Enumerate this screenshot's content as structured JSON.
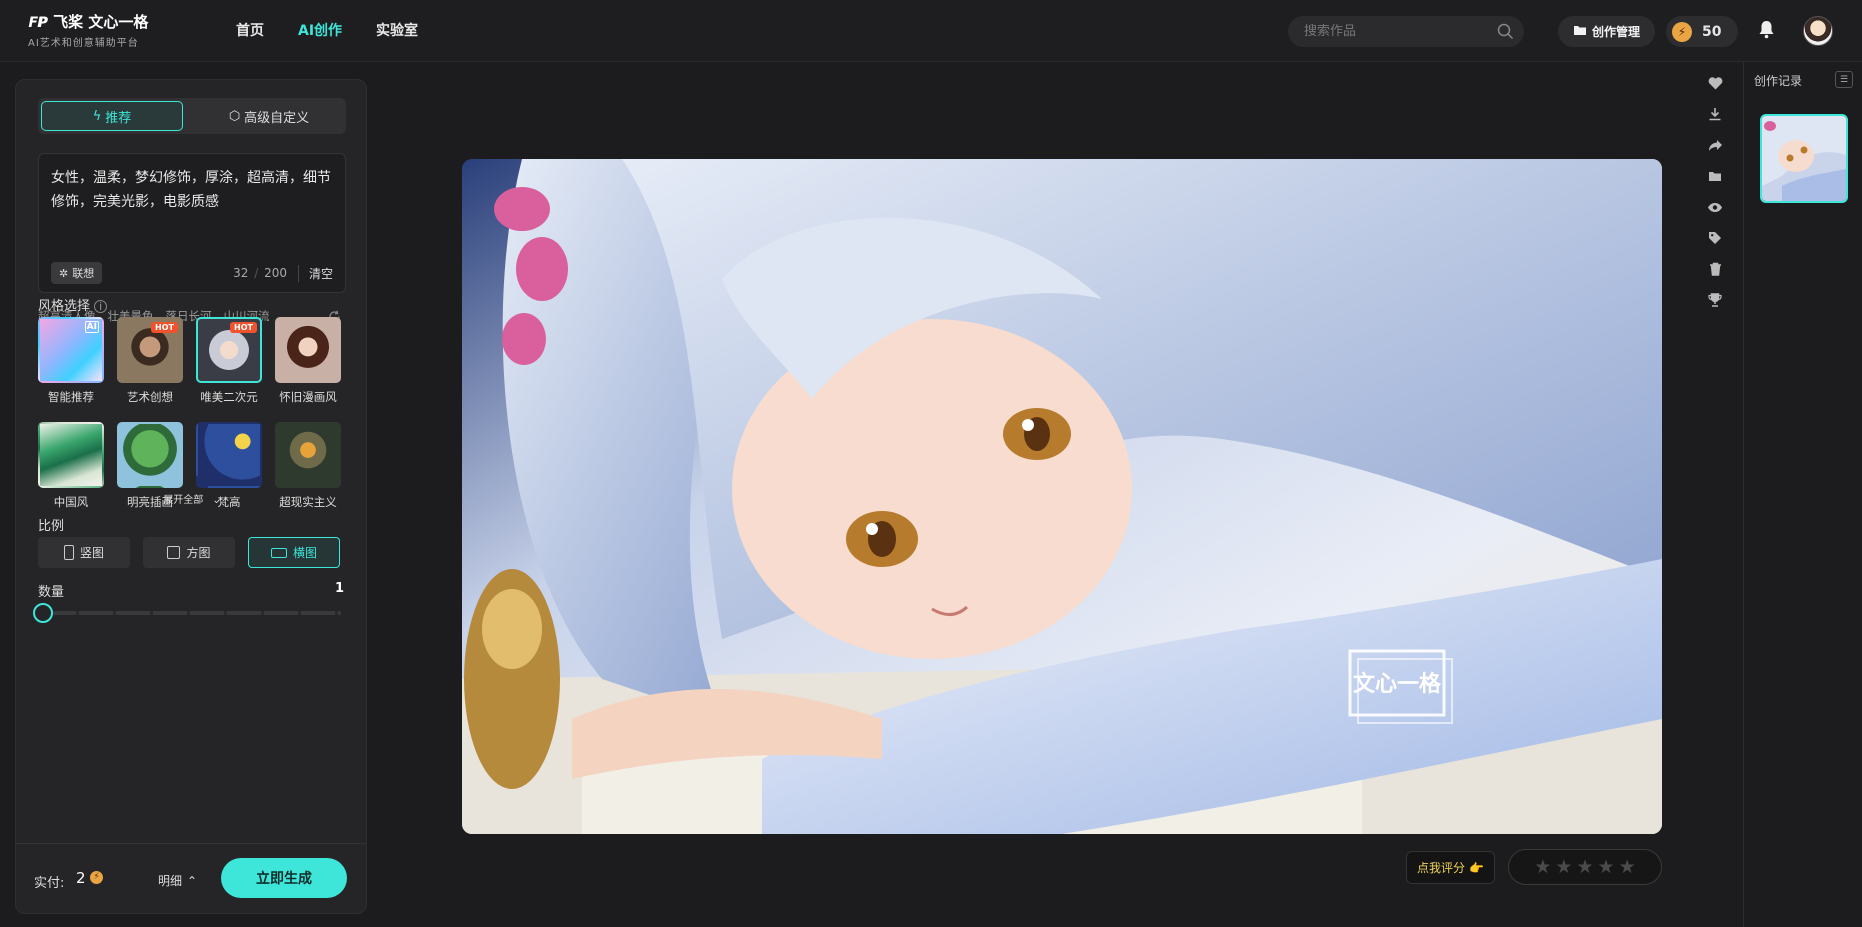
{
  "header": {
    "logo_mark": "飞桨",
    "logo_title": "飞桨 文心一格",
    "logo_subtitle": "AI艺术和创意辅助平台",
    "nav": [
      {
        "label": "首页"
      },
      {
        "label": "AI创作"
      },
      {
        "label": "实验室"
      }
    ],
    "search_placeholder": "搜索作品",
    "manage_label": "创作管理",
    "credits": "50"
  },
  "panel": {
    "tab_recommend": "推荐",
    "tab_advanced": "高级自定义",
    "prompt": "女性，温柔，梦幻修饰，厚涂，超高清，细节修饰，完美光影，电影质感",
    "assoc_label": "联想",
    "char_count": "32",
    "char_max": "200",
    "clear_label": "清空",
    "tags": [
      "超高清人像",
      "壮美景色",
      "落日长河",
      "山川河流"
    ],
    "style_title": "风格选择",
    "styles": [
      {
        "name": "智能推荐",
        "badge": "AI"
      },
      {
        "name": "艺术创想",
        "badge": "HOT"
      },
      {
        "name": "唯美二次元",
        "badge": "HOT"
      },
      {
        "name": "怀旧漫画风",
        "badge": ""
      },
      {
        "name": "中国风",
        "badge": ""
      },
      {
        "name": "明亮插画",
        "badge": ""
      },
      {
        "name": "梵高",
        "badge": ""
      },
      {
        "name": "超现实主义",
        "badge": ""
      }
    ],
    "expand_label": "展开全部",
    "ratio_title": "比例",
    "ratios": [
      {
        "label": "竖图"
      },
      {
        "label": "方图"
      },
      {
        "label": "横图"
      }
    ],
    "quantity_title": "数量",
    "quantity_value": "1",
    "pay_label": "实付:",
    "pay_value": "2",
    "detail_label": "明细",
    "generate_label": "立即生成"
  },
  "main": {
    "watermark": "文心一格",
    "rate_label": "点我评分",
    "stars": [
      "★",
      "★",
      "★",
      "★",
      "★"
    ]
  },
  "history": {
    "title": "创作记录"
  },
  "colors": {
    "accent": "#3ee6da",
    "background": "#1c1c1e",
    "panel": "#252527",
    "hot": "#f0522e"
  }
}
